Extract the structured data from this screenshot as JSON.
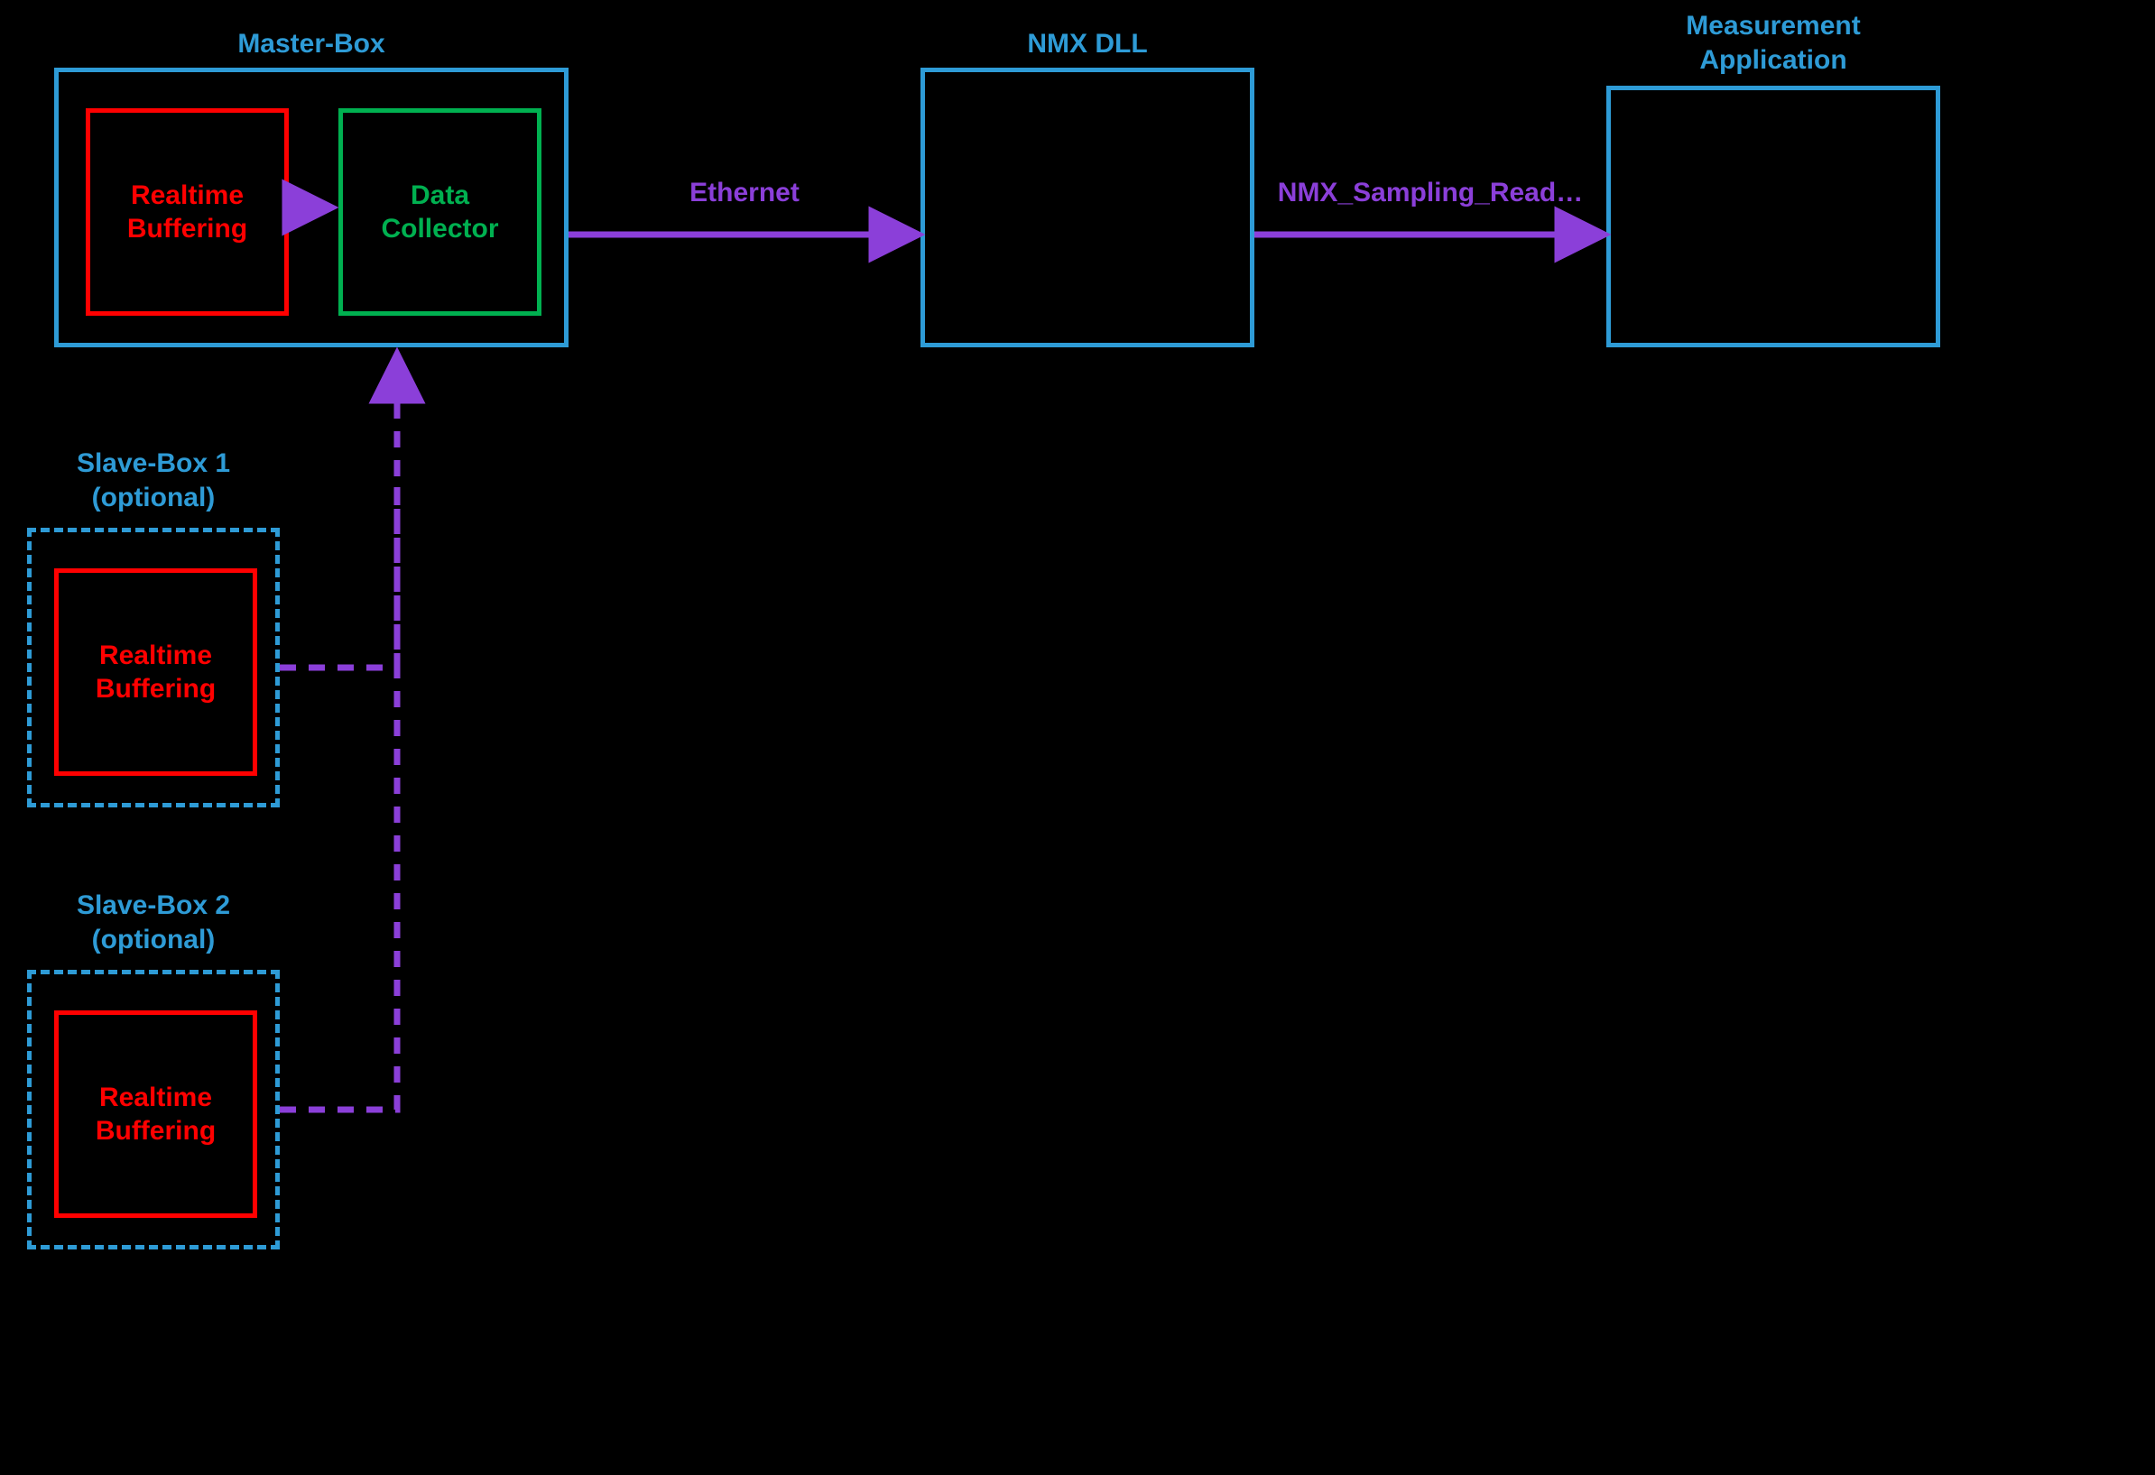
{
  "master": {
    "title": "Master-Box",
    "realtime": "Realtime\nBuffering",
    "collector": "Data\nCollector"
  },
  "slave1": {
    "title": "Slave-Box 1\n(optional)",
    "realtime": "Realtime\nBuffering"
  },
  "slave2": {
    "title": "Slave-Box 2\n(optional)",
    "realtime": "Realtime\nBuffering"
  },
  "nmx": {
    "title": "NMX DLL"
  },
  "app": {
    "title": "Measurement\nApplication"
  },
  "links": {
    "ethernet": "Ethernet",
    "sampling": "NMX_Sampling_Read…"
  },
  "colors": {
    "blue": "#2E9BD6",
    "red": "#FF0000",
    "green": "#00B050",
    "purple": "#8B3FD9"
  }
}
